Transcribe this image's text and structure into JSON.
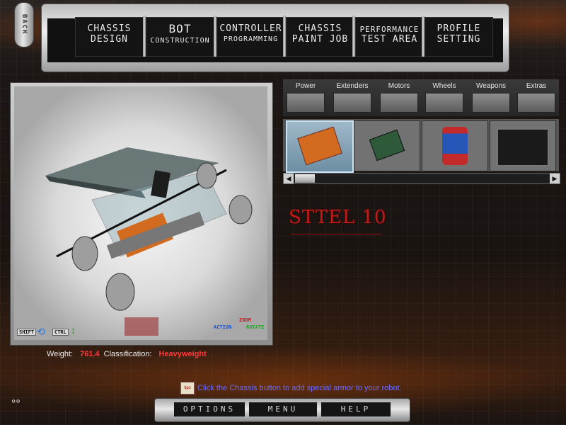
{
  "back_label": "BACK",
  "menu": [
    {
      "line1": "CHASSIS",
      "line2": "DESIGN"
    },
    {
      "line1": "BOT",
      "line2": "CONSTRUCTION"
    },
    {
      "line1": "CONTROLLER",
      "line2": "PROGRAMMING"
    },
    {
      "line1": "CHASSIS",
      "line2": "PAINT JOB"
    },
    {
      "line1": "PERFORMANCE",
      "line2": "TEST AREA"
    },
    {
      "line1": "PROFILE",
      "line2": "SETTING"
    }
  ],
  "viewport": {
    "hints": {
      "shift": "SHIFT",
      "ctrl": "CTRL",
      "action": "ACTION",
      "zoom": "ZOOM",
      "rotate": "ROTATE"
    }
  },
  "categories": [
    "Power",
    "Extenders",
    "Motors",
    "Wheels",
    "Weapons",
    "Extras"
  ],
  "items": [
    "armor-plate",
    "circuit-board",
    "canister",
    "battery-box"
  ],
  "part_name": "STTEL 10",
  "stats": {
    "weight_label": "Weight:",
    "weight_value": "761.4",
    "class_label": "Classification:",
    "class_value": "Heavyweight"
  },
  "tip": {
    "icon": "tips",
    "text": "Click the Chassis button to add special armor to your robot."
  },
  "bottom": {
    "options": "OPTIONS",
    "menu": "MENU",
    "help": "HELP"
  },
  "colors": {
    "accent_red": "#ff3b3b",
    "tip_blue": "#6b6bff"
  }
}
